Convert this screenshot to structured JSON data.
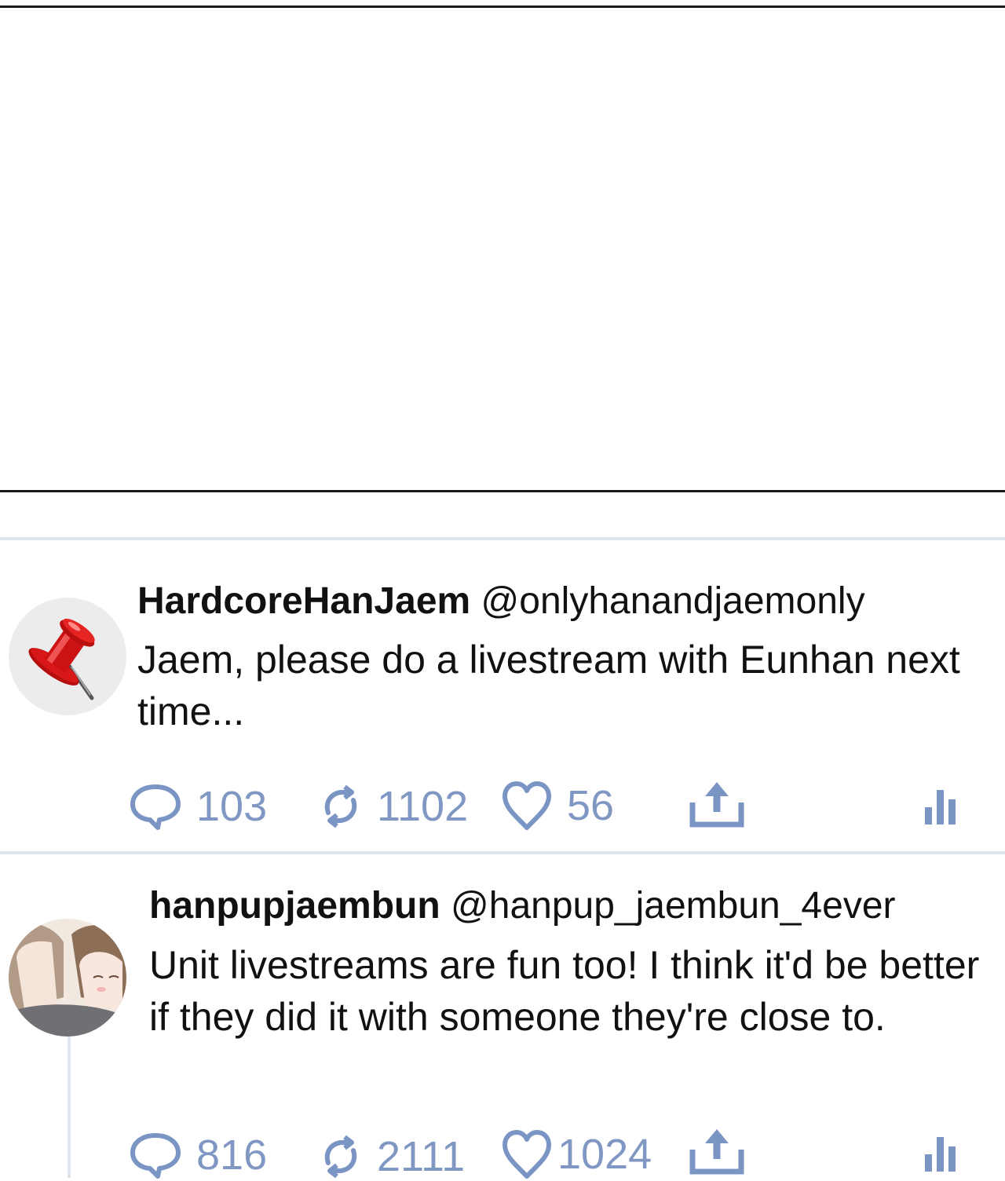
{
  "tweets": [
    {
      "name": "HardcoreHanJaem",
      "handle": "@onlyhanandjaemonly",
      "text": "Jaem, please do a livestream with Eunhan next time...",
      "replies": "103",
      "retweets": "1102",
      "likes": "56",
      "avatar_icon": "pushpin-icon"
    },
    {
      "name": "hanpupjaembun",
      "handle": "@hanpup_jaembun_4ever",
      "text": "Unit livestreams are fun too! I think it'd be better if they did it with someone they're close to.",
      "replies": "816",
      "retweets": "2111",
      "likes": "1024",
      "avatar_icon": "illustrated-couple-avatar"
    }
  ],
  "colors": {
    "action_icon": "#7a94c4",
    "divider": "#dfe5ee",
    "text": "#111111"
  }
}
